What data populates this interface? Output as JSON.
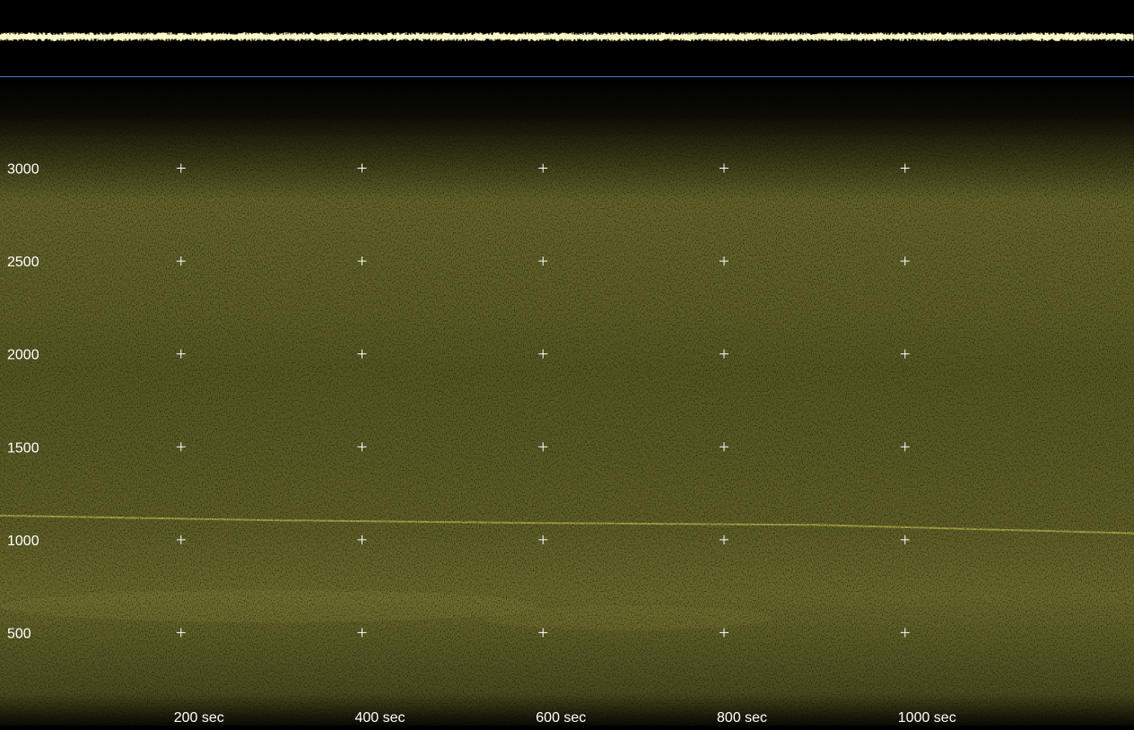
{
  "chart_data": {
    "type": "heatmap",
    "title": "",
    "xlabel": "",
    "ylabel": "",
    "x_ticks": [
      200,
      400,
      600,
      800,
      1000
    ],
    "x_tick_labels": [
      "200 sec",
      "400 sec",
      "600 sec",
      "800 sec",
      "1000 sec"
    ],
    "y_ticks": [
      3000,
      2500,
      2000,
      1500,
      1000,
      500
    ],
    "y_tick_labels": [
      "3000",
      "2500",
      "2000",
      "1500",
      "1000",
      "500"
    ],
    "xlim": [
      0,
      1253
    ],
    "ylim": [
      0,
      3490
    ],
    "grid": "cross markers",
    "tone_line": {
      "x": [
        0,
        300,
        600,
        900,
        1253
      ],
      "y": [
        1130,
        1105,
        1090,
        1080,
        1035
      ]
    },
    "colors": {
      "waveform": "#fff8c8",
      "spectrogram": "#6a6a2c",
      "divider": "#3f7fd0",
      "tone": "#b8b84a"
    }
  }
}
